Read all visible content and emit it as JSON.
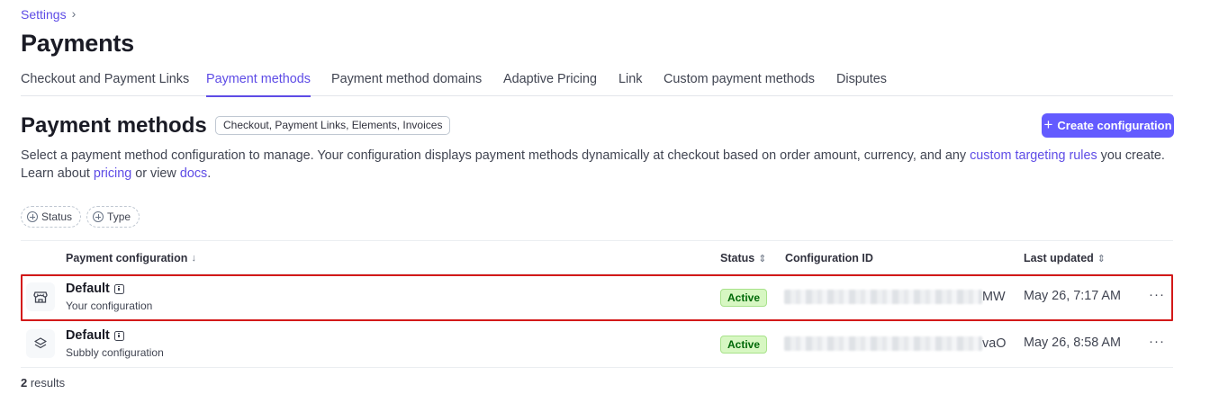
{
  "breadcrumb": {
    "parent": "Settings"
  },
  "page": {
    "title": "Payments"
  },
  "tabs": [
    {
      "label": "Checkout and Payment Links",
      "active": false
    },
    {
      "label": "Payment methods",
      "active": true
    },
    {
      "label": "Payment method domains",
      "active": false
    },
    {
      "label": "Adaptive Pricing",
      "active": false
    },
    {
      "label": "Link",
      "active": false
    },
    {
      "label": "Custom payment methods",
      "active": false
    },
    {
      "label": "Disputes",
      "active": false
    }
  ],
  "section": {
    "title": "Payment methods",
    "badge": "Checkout, Payment Links, Elements, Invoices",
    "create_label": "Create configuration",
    "description": {
      "part1": "Select a payment method configuration to manage. Your configuration displays payment methods dynamically at checkout based on order amount, currency, and any ",
      "link1": "custom targeting rules",
      "part2": " you create. Learn about ",
      "link2": "pricing",
      "part3": " or view ",
      "link3": "docs",
      "part4": "."
    }
  },
  "filters": {
    "status": "Status",
    "type": "Type"
  },
  "table": {
    "columns": {
      "config": "Payment configuration",
      "status": "Status",
      "config_id": "Configuration ID",
      "updated": "Last updated"
    },
    "rows": [
      {
        "name": "Default",
        "subtitle": "Your configuration",
        "status": "Active",
        "id_suffix": "MW",
        "updated": "May 26, 7:17 AM",
        "icon": "store-icon"
      },
      {
        "name": "Default",
        "subtitle": "Subbly configuration",
        "status": "Active",
        "id_suffix": "vaO",
        "updated": "May 26, 8:58 AM",
        "icon": "layers-icon"
      }
    ]
  },
  "footer": {
    "count": "2",
    "label": " results"
  },
  "colors": {
    "accent": "#635bff",
    "link": "#5e4ce6",
    "active_bg": "#d7f7c2",
    "active_text": "#006908",
    "highlight": "#d31919"
  }
}
